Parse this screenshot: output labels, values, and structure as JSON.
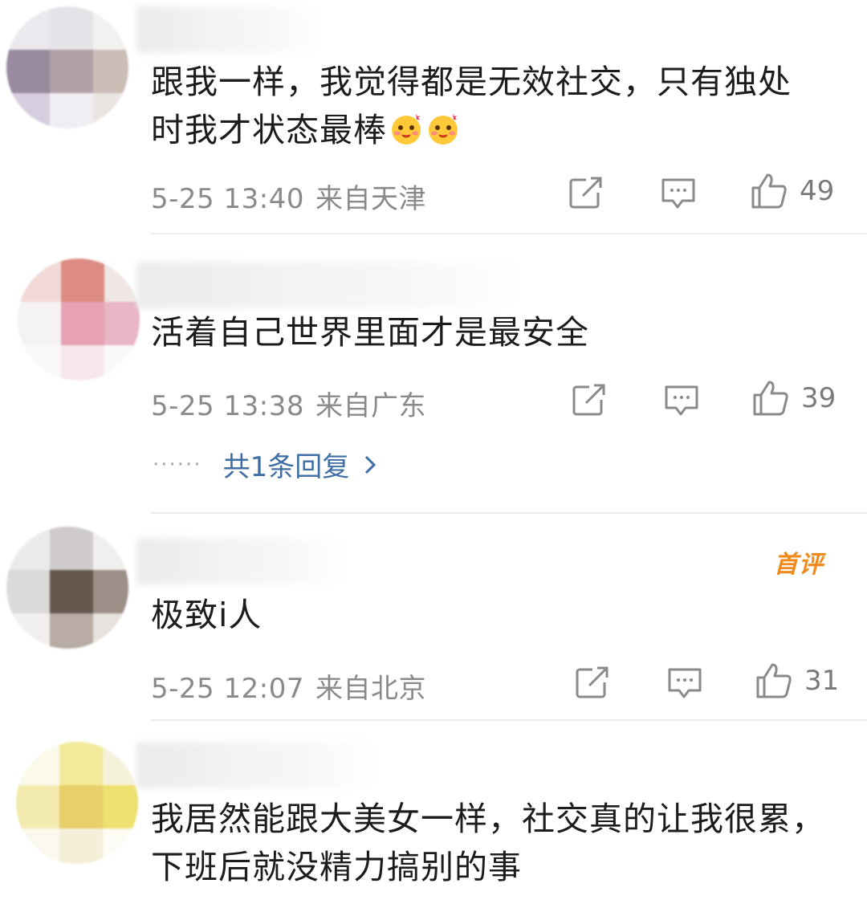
{
  "comments": [
    {
      "text_lines": [
        "跟我一样，我觉得都是无效社交，只有独处",
        "时我才状态最棒"
      ],
      "emoji": [
        "blushing-hug-emoji",
        "blushing-hug-emoji"
      ],
      "date": "5-25 13:40",
      "location": "来自天津",
      "likes": "49"
    },
    {
      "text_lines": [
        "活着自己世界里面才是最安全"
      ],
      "date": "5-25 13:38",
      "location": "来自广东",
      "likes": "39",
      "replies_label": "共1条回复"
    },
    {
      "badge": "首评",
      "text_lines": [
        "极致i人"
      ],
      "date": "5-25 12:07",
      "location": "来自北京",
      "likes": "31"
    },
    {
      "text_lines": [
        "我居然能跟大美女一样，社交真的让我很累，",
        "下班后就没精力搞别的事"
      ]
    }
  ],
  "colors": {
    "text": "#1c1c1c",
    "meta": "#8a8a8a",
    "reply_link": "#3e6ea5",
    "badge": "#f08a1c",
    "divider": "#ececec"
  },
  "icons": {
    "share": "share-icon",
    "comment": "comment-icon",
    "like": "thumbs-up-icon",
    "reply_chevron": "chevron-right-icon"
  }
}
